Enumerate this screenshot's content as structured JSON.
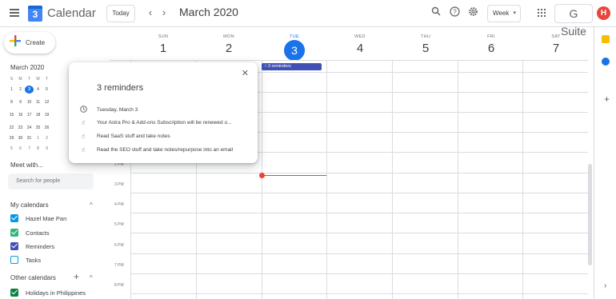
{
  "header": {
    "app_name": "Calendar",
    "logo_text": "3",
    "today_label": "Today",
    "month_title": "March 2020",
    "view_label": "Week",
    "brand": "G Suite",
    "avatar_initial": "H"
  },
  "sidebar": {
    "create_label": "Create",
    "mini_month": "March 2020",
    "mini_dow": [
      "S",
      "M",
      "T",
      "W",
      "T"
    ],
    "mini_rows": [
      [
        "1",
        "2",
        "3",
        "4",
        "5"
      ],
      [
        "8",
        "9",
        "10",
        "11",
        "12"
      ],
      [
        "15",
        "16",
        "17",
        "18",
        "19"
      ],
      [
        "22",
        "23",
        "24",
        "25",
        "26"
      ],
      [
        "29",
        "30",
        "31",
        "1",
        "2"
      ],
      [
        "5",
        "6",
        "7",
        "8",
        "9"
      ]
    ],
    "meet_title": "Meet with...",
    "search_placeholder": "Search for people",
    "my_calendars_title": "My calendars",
    "my_calendars": [
      {
        "label": "Hazel Mae Pan",
        "color": "#039be5",
        "checked": true
      },
      {
        "label": "Contacts",
        "color": "#33b679",
        "checked": true
      },
      {
        "label": "Reminders",
        "color": "#3f51b5",
        "checked": true
      },
      {
        "label": "Tasks",
        "color": "#039be5",
        "checked": false
      }
    ],
    "other_calendars_title": "Other calendars",
    "other_calendars": [
      {
        "label": "Holidays in Philippines",
        "color": "#0b8043",
        "checked": true
      }
    ]
  },
  "week": {
    "days": [
      {
        "dow": "SUN",
        "num": "1"
      },
      {
        "dow": "MON",
        "num": "2"
      },
      {
        "dow": "TUE",
        "num": "3",
        "today": true
      },
      {
        "dow": "WED",
        "num": "4"
      },
      {
        "dow": "THU",
        "num": "5"
      },
      {
        "dow": "FRI",
        "num": "6"
      },
      {
        "dow": "SAT",
        "num": "7"
      }
    ],
    "hours": [
      "2 PM",
      "3 PM",
      "4 PM",
      "5 PM",
      "6 PM",
      "7 PM",
      "8 PM"
    ],
    "reminder_chip": "3 reminders"
  },
  "popup": {
    "title": "3 reminders",
    "date": "Tuesday, March 3",
    "items": [
      "Your Astra Pro & Add-ons Subscription will be renewed o...",
      "Read SaaS stuff and take notes",
      "Read the SEO stuff and take notes/repurpose into an email"
    ]
  },
  "colors": {
    "accent": "#1a73e8",
    "reminder": "#3f51b5",
    "now": "#ea4335"
  }
}
